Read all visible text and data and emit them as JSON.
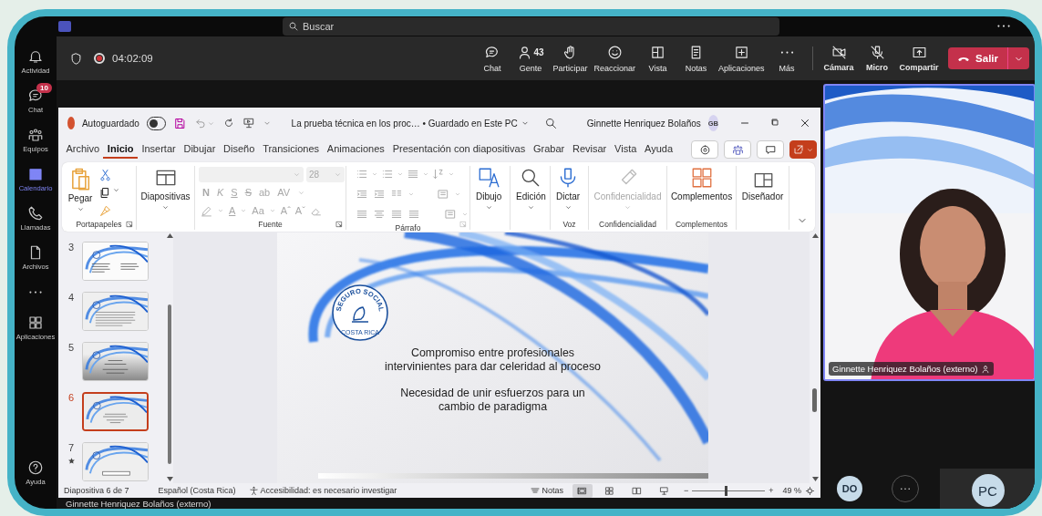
{
  "teams": {
    "search": {
      "placeholder": "Buscar"
    },
    "rail": [
      {
        "label": "Actividad",
        "selected": false
      },
      {
        "label": "Chat",
        "selected": false,
        "badge": "10"
      },
      {
        "label": "Equipos",
        "selected": false
      },
      {
        "label": "Calendario",
        "selected": true
      },
      {
        "label": "Llamadas",
        "selected": false
      },
      {
        "label": "Archivos",
        "selected": false
      },
      {
        "label": "Aplicaciones",
        "selected": false
      }
    ],
    "help": "Ayuda"
  },
  "meeting": {
    "recording": true,
    "timer": "04:02:09",
    "actions": [
      {
        "label": "Chat"
      },
      {
        "label": "Gente",
        "count": "43"
      },
      {
        "label": "Participar"
      },
      {
        "label": "Reaccionar"
      },
      {
        "label": "Vista"
      },
      {
        "label": "Notas"
      },
      {
        "label": "Aplicaciones"
      },
      {
        "label": "Más"
      }
    ],
    "devices": [
      {
        "label": "Cámara",
        "off": true
      },
      {
        "label": "Micro",
        "off": true
      },
      {
        "label": "Compartir",
        "off": false
      }
    ],
    "leave": "Salir"
  },
  "powerpoint": {
    "autosave": {
      "label": "Autoguardado",
      "on": false
    },
    "title": "La prueba técnica en los proc… • Guardado en Este PC",
    "user": {
      "name": "Ginnette Henriquez Bolaños",
      "initials": "GB"
    },
    "tabs": [
      {
        "label": "Archivo",
        "selected": false
      },
      {
        "label": "Inicio",
        "selected": true
      },
      {
        "label": "Insertar",
        "selected": false
      },
      {
        "label": "Dibujar",
        "selected": false
      },
      {
        "label": "Diseño",
        "selected": false
      },
      {
        "label": "Transiciones",
        "selected": false
      },
      {
        "label": "Animaciones",
        "selected": false
      },
      {
        "label": "Presentación con diapositivas",
        "selected": false
      },
      {
        "label": "Grabar",
        "selected": false
      },
      {
        "label": "Revisar",
        "selected": false
      },
      {
        "label": "Vista",
        "selected": false
      },
      {
        "label": "Ayuda",
        "selected": false
      }
    ],
    "ribbon": {
      "clipboard": {
        "label": "Portapapeles",
        "paste": "Pegar"
      },
      "slides": {
        "button": "Diapositivas"
      },
      "font": {
        "label": "Fuente",
        "disabled": true,
        "size": "28",
        "styles": [
          "N",
          "K",
          "S",
          "S",
          "ab",
          "AV"
        ],
        "color_letter": "A",
        "case": "Aa",
        "grow": "Aˆ",
        "shrink": "Aˇ"
      },
      "paragraph": {
        "label": "Párrafo"
      },
      "drawing": {
        "button": "Dibujo"
      },
      "editing": {
        "button": "Edición"
      },
      "voice": {
        "label": "Voz",
        "button": "Dictar"
      },
      "sensitivity": {
        "label": "Confidencialidad",
        "button": "Confidencialidad",
        "disabled": true
      },
      "addins": {
        "label": "Complementos",
        "button": "Complementos"
      },
      "designer": {
        "button": "Diseñador"
      }
    },
    "slides": [
      {
        "number": "3",
        "selected": false,
        "kind": "columns",
        "animated": false
      },
      {
        "number": "4",
        "selected": false,
        "kind": "text",
        "animated": false
      },
      {
        "number": "5",
        "selected": false,
        "kind": "dark",
        "animated": false
      },
      {
        "number": "6",
        "selected": true,
        "kind": "centered",
        "animated": false
      },
      {
        "number": "7",
        "selected": false,
        "kind": "button",
        "animated": true
      }
    ],
    "slide": {
      "logo": {
        "top": "SEGURO SOCIAL",
        "bottom": "COSTA RICA"
      },
      "paragraphs": [
        "Compromiso entre profesionales\nintervinientes para dar celeridad al proceso",
        "Necesidad de unir esfuerzos para un\ncambio de paradigma"
      ]
    },
    "status": {
      "slide_info": "Diapositiva 6 de 7",
      "language": "Español (Costa Rica)",
      "accessibility": "Accesibilidad: es necesario investigar",
      "notes": "Notas",
      "views": [
        {
          "selected": true
        },
        {
          "selected": false
        },
        {
          "selected": false
        },
        {
          "selected": false
        }
      ],
      "zoom": {
        "out": "−",
        "in": "+",
        "level": 0.45,
        "reading": "49 %"
      }
    }
  },
  "side": {
    "video": {
      "name": "Ginnette Henriquez Bolaños (externo)",
      "speaking": true
    },
    "participants": [
      {
        "initials": "DO",
        "kind": "avatar"
      },
      {
        "initials": "PC",
        "kind": "tile"
      }
    ]
  },
  "caption": "Ginnette Henriquez Bolaños (externo)"
}
